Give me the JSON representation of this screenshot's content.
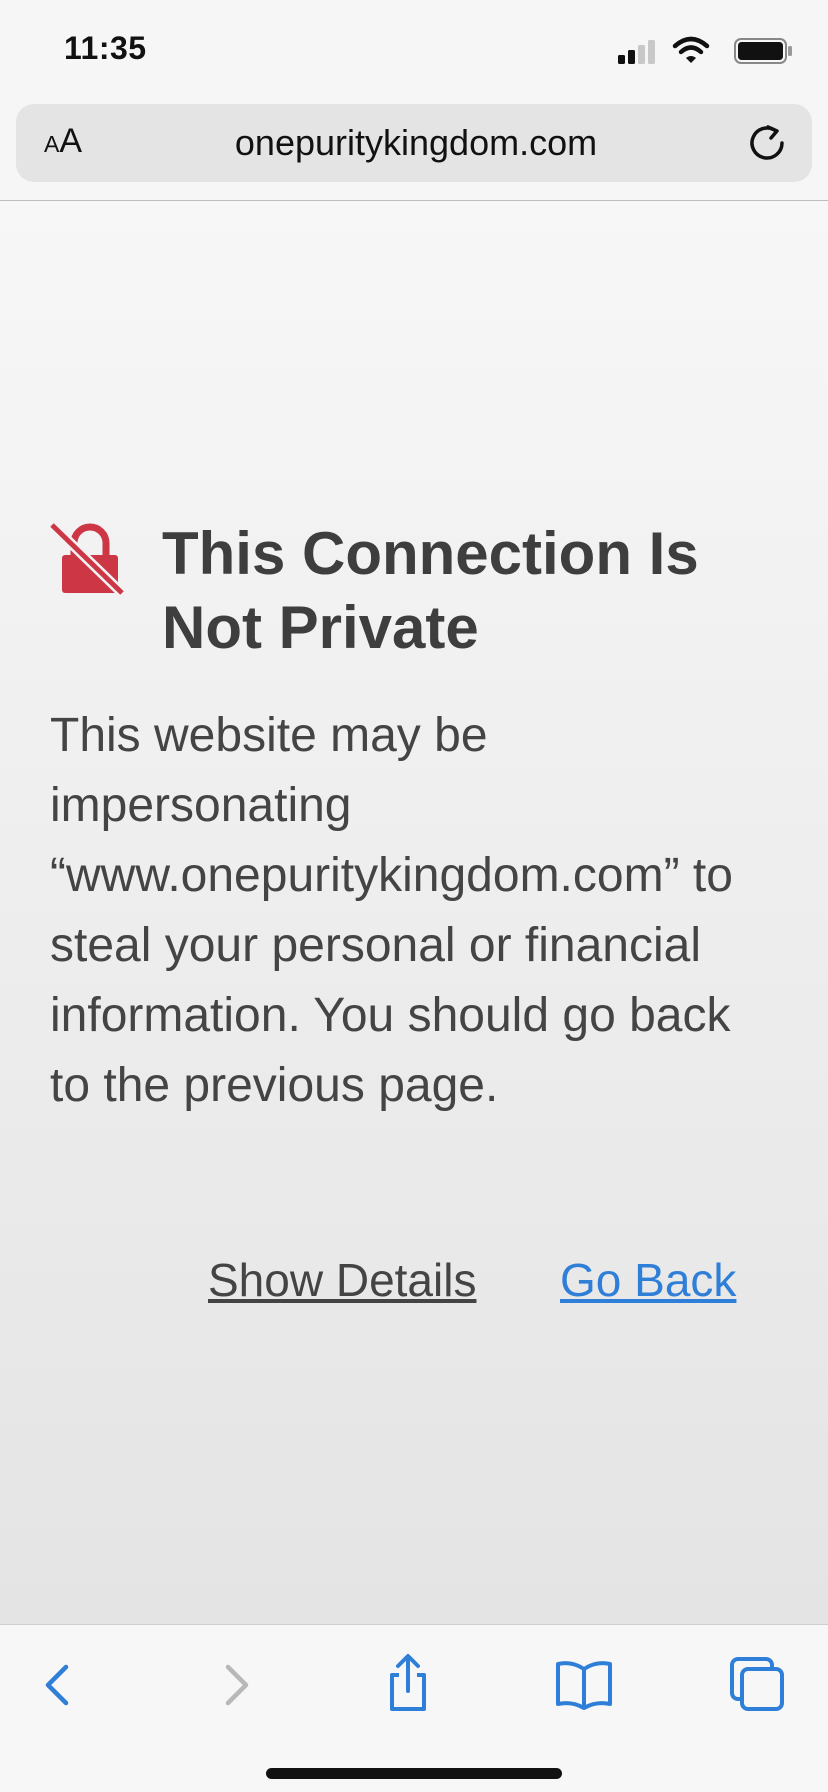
{
  "status_bar": {
    "time": "11:35"
  },
  "address_bar": {
    "reader_label_small": "A",
    "reader_label_large": "A",
    "url": "onepuritykingdom.com"
  },
  "warning": {
    "title": "This Connection Is Not Private",
    "message": "This website may be impersonating “www.onepuritykingdom.com” to steal your personal or financial information. You should go back to the previous page.",
    "show_details": "Show Details",
    "go_back": "Go Back"
  },
  "icons": {
    "warning": "broken-lock-icon",
    "reload": "reload-icon",
    "back": "chevron-left-icon",
    "forward": "chevron-right-icon",
    "share": "share-icon",
    "bookmarks": "book-icon",
    "tabs": "tabs-icon"
  },
  "colors": {
    "accent": "#2f7fd8",
    "warning_red": "#cc3645",
    "title_text": "#3e3e3e"
  }
}
